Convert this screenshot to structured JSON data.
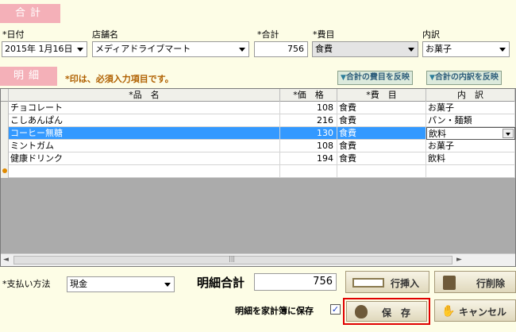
{
  "header": {
    "total_section": "合計",
    "detail_section": "明細"
  },
  "summary": {
    "date_label": "*日付",
    "date_value": "2015年 1月16日",
    "store_label": "店舗名",
    "store_value": "メディアドライブマート",
    "total_label": "*合計",
    "total_value": "756",
    "category_label": "*費目",
    "category_value": "食費",
    "breakdown_label": "内訳",
    "breakdown_value": "お菓子"
  },
  "detail": {
    "required_note": "*印は、必須入力項目です。",
    "reflect_category_btn": "合計の費目を反映",
    "reflect_breakdown_btn": "合計の内訳を反映"
  },
  "table": {
    "columns": [
      "*品　名",
      "*価　格",
      "*費　目",
      "内　訳"
    ],
    "rows": [
      {
        "name": "チョコレート",
        "price": "108",
        "category": "食費",
        "breakdown": "お菓子",
        "selected": false
      },
      {
        "name": "こしあんぱん",
        "price": "216",
        "category": "食費",
        "breakdown": "パン・麺類",
        "selected": false
      },
      {
        "name": "コーヒー無糖",
        "price": "130",
        "category": "食費",
        "breakdown": "飲料",
        "selected": true
      },
      {
        "name": "ミントガム",
        "price": "108",
        "category": "食費",
        "breakdown": "お菓子",
        "selected": false
      },
      {
        "name": "健康ドリンク",
        "price": "194",
        "category": "食費",
        "breakdown": "飲料",
        "selected": false
      }
    ]
  },
  "footer": {
    "payment_label": "*支払い方法",
    "payment_value": "現金",
    "detail_total_label": "明細合計",
    "detail_total_value": "756",
    "insert_row_btn": "行挿入",
    "delete_row_btn": "行削除",
    "save_to_book_label": "明細を家計簿に保存",
    "save_to_book_checked": "✓",
    "save_btn": "保　存",
    "cancel_btn": "キャンセル"
  },
  "colors": {
    "section_tab": "#f4b0b8",
    "selection": "#3399ff",
    "save_frame": "#e00000",
    "note": "#b06000"
  }
}
